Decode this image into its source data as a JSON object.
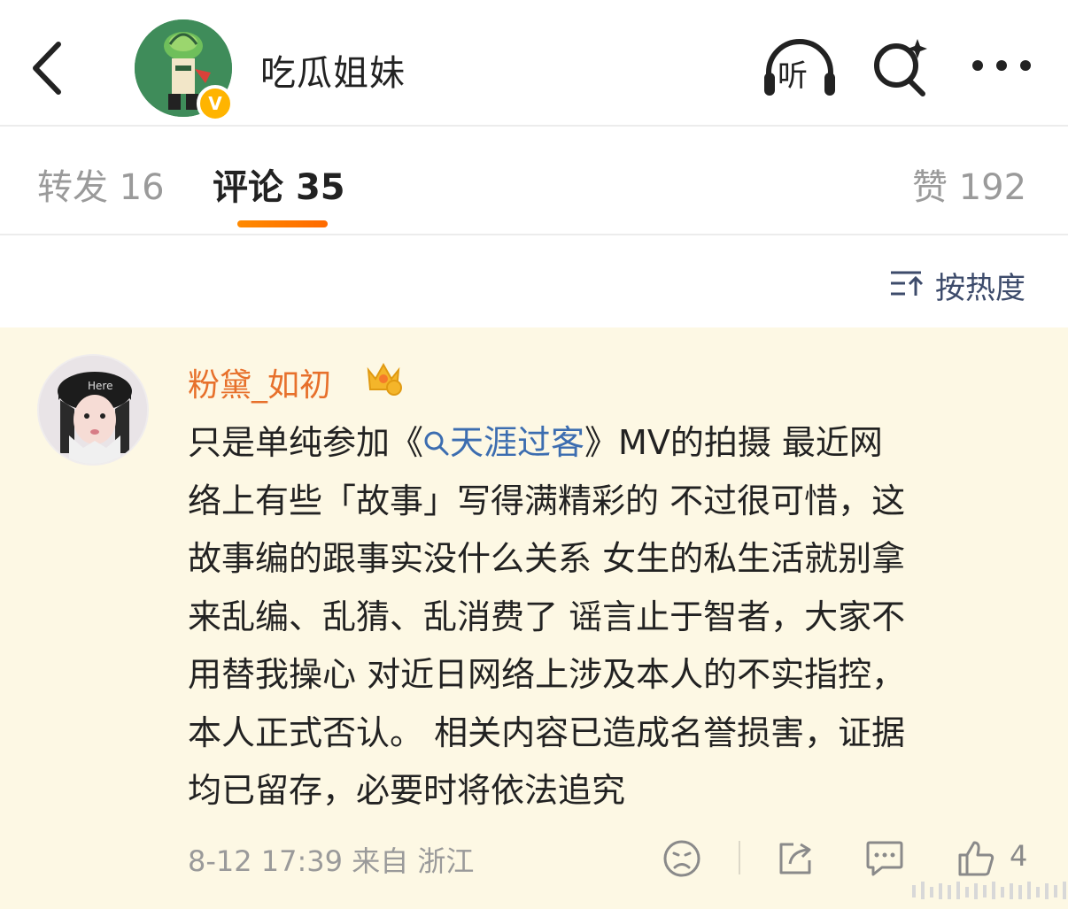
{
  "header": {
    "title": "吃瓜姐妹",
    "verified_badge": "V",
    "listen_label": "听",
    "icons": [
      "back-icon",
      "headphones-icon",
      "search-sparkle-icon",
      "more-icon"
    ]
  },
  "tabs": {
    "repost": {
      "label": "转发",
      "count": "16"
    },
    "comment": {
      "label": "评论",
      "count": "35"
    },
    "like": {
      "label": "赞",
      "count": "192"
    },
    "active": "comment",
    "accent": "#ff7a00"
  },
  "sort": {
    "label": "按热度",
    "icon": "sort-icon"
  },
  "comment": {
    "username": "粉黛_如初",
    "username_color": "#e7702b",
    "badge": "crown-icon",
    "text_lines": [
      {
        "before": "只是单纯参加《",
        "link": "天涯过客",
        "after": "》MV的拍摄 最近网"
      },
      {
        "text": "络上有些「故事」写得满精彩的 不过很可惜，这"
      },
      {
        "text": "故事编的跟事实没什么关系 女生的私生活就别拿"
      },
      {
        "text": "来乱编、乱猜、乱消费了 谣言止于智者，大家不"
      },
      {
        "text": "用替我操心 对近日网络上涉及本人的不实指控，"
      },
      {
        "text": "本人正式否认。 相关内容已造成名誉损害，证据"
      },
      {
        "text": "均已留存，必要时将依法追究"
      }
    ],
    "meta": "8-12 17:39 来自 浙江",
    "like_count": "4",
    "background": "#fdf8e4",
    "link_color": "#3c6db0"
  }
}
